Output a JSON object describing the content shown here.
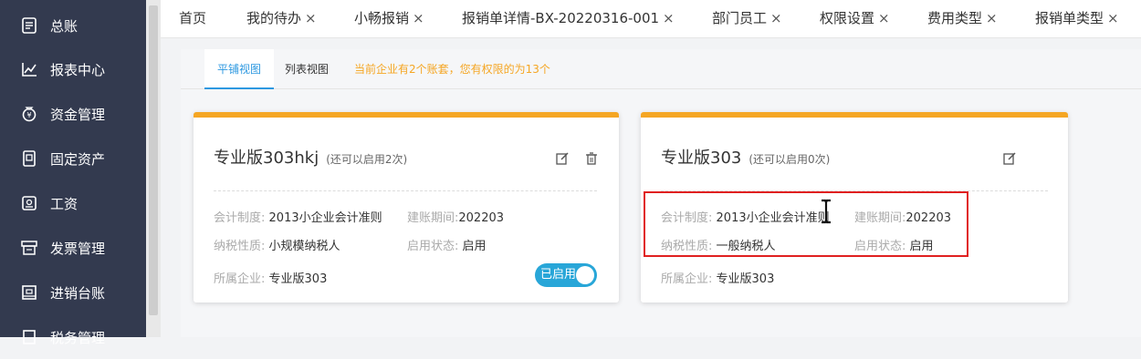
{
  "sidebar": {
    "items": [
      {
        "label": "总账",
        "icon": "ledger-icon"
      },
      {
        "label": "报表中心",
        "icon": "chart-icon"
      },
      {
        "label": "资金管理",
        "icon": "money-bag-icon"
      },
      {
        "label": "固定资产",
        "icon": "asset-icon"
      },
      {
        "label": "工资",
        "icon": "salary-icon"
      },
      {
        "label": "发票管理",
        "icon": "invoice-icon"
      },
      {
        "label": "进销台账",
        "icon": "inventory-icon"
      },
      {
        "label": "税务管理",
        "icon": "tax-icon"
      }
    ]
  },
  "tabs": [
    {
      "label": "首页",
      "closable": false
    },
    {
      "label": "我的待办",
      "closable": true
    },
    {
      "label": "小畅报销",
      "closable": true
    },
    {
      "label": "报销单详情-BX-20220316-001",
      "closable": true
    },
    {
      "label": "部门员工",
      "closable": true
    },
    {
      "label": "权限设置",
      "closable": true
    },
    {
      "label": "费用类型",
      "closable": true
    },
    {
      "label": "报销单类型",
      "closable": true
    }
  ],
  "tab_close_glyph": "×",
  "subtabs": {
    "tile_view": "平铺视图",
    "list_view": "列表视图",
    "notice": "当前企业有2个账套，您有权限的为13个"
  },
  "cards": [
    {
      "title": "专业版303hkj",
      "hint": "(还可以启用2次)",
      "accounting_system_key": "会计制度:",
      "accounting_system": "2013小企业会计准则",
      "period_key": "建账期间:",
      "period": "202203",
      "taxpayer_key": "纳税性质:",
      "taxpayer": "小规模纳税人",
      "status_key": "启用状态:",
      "status": "启用",
      "company_key": "所属企业:",
      "company": "专业版303",
      "toggle_label": "已启用"
    },
    {
      "title": "专业版303",
      "hint": "(还可以启用0次)",
      "accounting_system_key": "会计制度:",
      "accounting_system": "2013小企业会计准则",
      "period_key": "建账期间:",
      "period": "202203",
      "taxpayer_key": "纳税性质:",
      "taxpayer": "一般纳税人",
      "status_key": "启用状态:",
      "status": "启用",
      "company_key": "所属企业:",
      "company": "专业版303"
    }
  ],
  "colors": {
    "sidebar_bg": "#333a4f",
    "accent": "#2d98e0",
    "card_top": "#f5a623",
    "toggle_on": "#28a6d8",
    "highlight": "#e02020"
  }
}
